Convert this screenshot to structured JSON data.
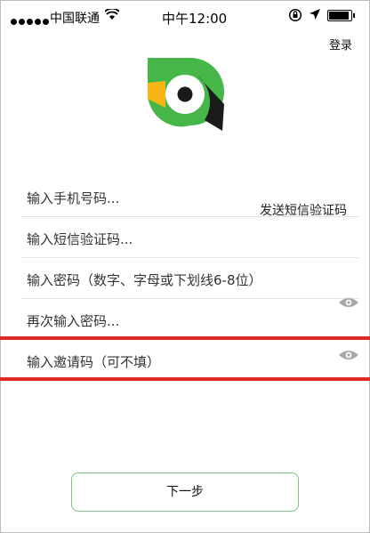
{
  "status_bar": {
    "carrier": "中国联通",
    "time": "中午12:00"
  },
  "header": {
    "login_link": "登录"
  },
  "form": {
    "phone_placeholder": "输入手机号码...",
    "send_sms_button": "发送短信验证码",
    "sms_code_placeholder": "输入短信验证码...",
    "password_placeholder": "输入密码（数字、字母或下划线6-8位）",
    "confirm_password_placeholder": "再次输入密码...",
    "invite_code_placeholder": "输入邀请码（可不填）"
  },
  "actions": {
    "next_label": "下一步"
  },
  "colors": {
    "highlight": "#e02a2a",
    "brand_green": "#46b649",
    "brand_yellow": "#f7b614",
    "brand_dark": "#1b1b1b"
  },
  "icons": {
    "eye": "eye-icon",
    "logo": "parrot-logo"
  }
}
